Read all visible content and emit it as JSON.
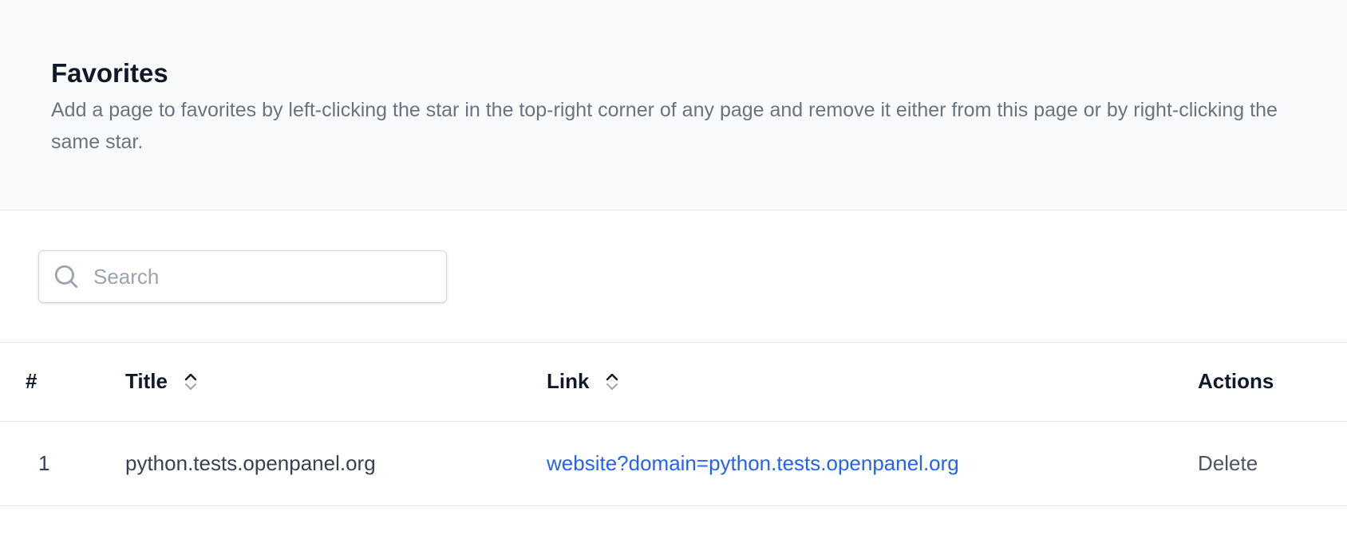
{
  "header": {
    "title": "Favorites",
    "description": "Add a page to favorites by left-clicking the star in the top-right corner of any page and remove it either from this page or by right-clicking the same star."
  },
  "search": {
    "placeholder": "Search",
    "value": "",
    "icon": "search-icon"
  },
  "table": {
    "columns": {
      "num": "#",
      "title": "Title",
      "link": "Link",
      "actions": "Actions"
    },
    "sort_icons": [
      "chevron-up-icon",
      "chevron-down-icon"
    ],
    "rows": [
      {
        "num": "1",
        "title": "python.tests.openpanel.org",
        "link": "website?domain=python.tests.openpanel.org",
        "action": "Delete"
      }
    ]
  },
  "colors": {
    "link": "#2563eb",
    "header_bg": "#f9fafb",
    "muted_text": "#6b7280"
  }
}
